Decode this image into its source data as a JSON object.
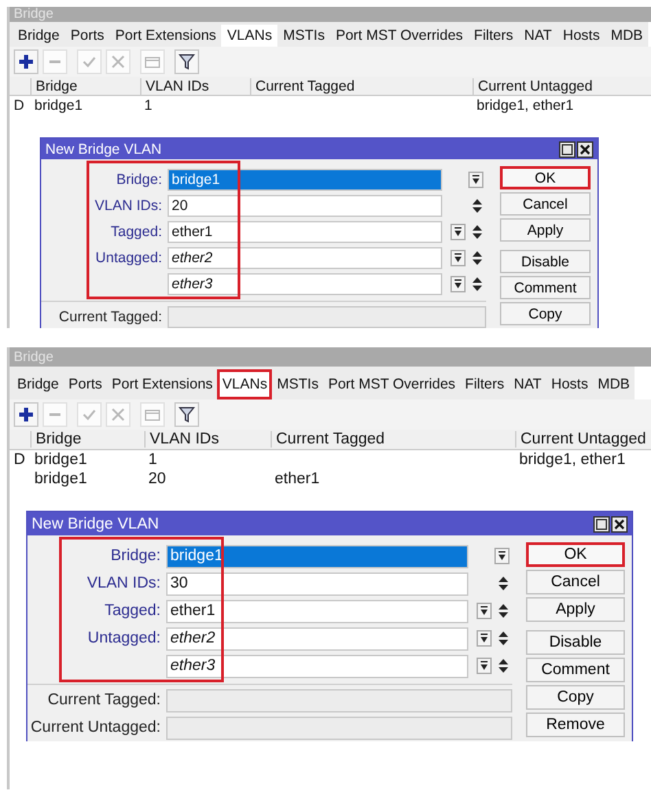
{
  "panels": [
    {
      "window_title": "Bridge",
      "tabs": [
        {
          "label": "Bridge",
          "selected": false,
          "highlighted": false
        },
        {
          "label": "Ports",
          "selected": false,
          "highlighted": false
        },
        {
          "label": "Port Extensions",
          "selected": false,
          "highlighted": false
        },
        {
          "label": "VLANs",
          "selected": true,
          "highlighted": false
        },
        {
          "label": "MSTIs",
          "selected": false,
          "highlighted": false
        },
        {
          "label": "Port MST Overrides",
          "selected": false,
          "highlighted": false
        },
        {
          "label": "Filters",
          "selected": false,
          "highlighted": false
        },
        {
          "label": "NAT",
          "selected": false,
          "highlighted": false
        },
        {
          "label": "Hosts",
          "selected": false,
          "highlighted": false
        },
        {
          "label": "MDB",
          "selected": false,
          "highlighted": false
        }
      ],
      "toolbar": [
        {
          "kind": "add",
          "disabled": false
        },
        {
          "kind": "remove",
          "disabled": true
        },
        {
          "kind": "enable",
          "disabled": true
        },
        {
          "kind": "disable",
          "disabled": true
        },
        {
          "kind": "comment",
          "disabled": true
        },
        {
          "kind": "filter",
          "disabled": false
        }
      ],
      "table": {
        "columns": [
          "Bridge",
          "VLAN IDs",
          "Current Tagged",
          "Current Untagged"
        ],
        "rows": [
          {
            "flag": "D",
            "bridge": "bridge1",
            "vlan_ids": "1",
            "current_untagged": "bridge1, ether1"
          }
        ]
      },
      "dialog": {
        "title": "New Bridge VLAN",
        "fields": [
          {
            "label": "Bridge:",
            "value": {
              "text": "bridge1",
              "kind": "selected"
            },
            "kind": "dropdown",
            "highlighted": true
          },
          {
            "label": "VLAN IDs:",
            "value": {
              "text": "20",
              "kind": "plain"
            },
            "kind": "spin",
            "highlighted": true
          },
          {
            "label": "Tagged:",
            "value": {
              "text": "ether1",
              "kind": "plain"
            },
            "kind": "dropdown-spin",
            "highlighted": true
          },
          {
            "label": "Untagged:",
            "value": {
              "text": "ether2",
              "kind": "italic"
            },
            "kind": "dropdown-spin",
            "highlighted": true
          },
          {
            "value": {
              "text": "ether3",
              "kind": "italic"
            },
            "kind": "dropdown-spin",
            "highlighted": true
          },
          {
            "label": "Current Tagged:",
            "kind": "readonly"
          }
        ],
        "buttons": [
          {
            "label": "OK",
            "highlighted": true
          },
          {
            "label": "Cancel",
            "highlighted": false
          },
          {
            "label": "Apply",
            "highlighted": false
          },
          {
            "label": "Disable",
            "highlighted": false
          },
          {
            "label": "Comment",
            "highlighted": false
          },
          {
            "label": "Copy",
            "highlighted": false
          }
        ]
      }
    },
    {
      "window_title": "Bridge",
      "tabs": [
        {
          "label": "Bridge",
          "selected": false,
          "highlighted": false
        },
        {
          "label": "Ports",
          "selected": false,
          "highlighted": false
        },
        {
          "label": "Port Extensions",
          "selected": false,
          "highlighted": false
        },
        {
          "label": "VLANs",
          "selected": true,
          "highlighted": true
        },
        {
          "label": "MSTIs",
          "selected": false,
          "highlighted": false
        },
        {
          "label": "Port MST Overrides",
          "selected": false,
          "highlighted": false
        },
        {
          "label": "Filters",
          "selected": false,
          "highlighted": false
        },
        {
          "label": "NAT",
          "selected": false,
          "highlighted": false
        },
        {
          "label": "Hosts",
          "selected": false,
          "highlighted": false
        },
        {
          "label": "MDB",
          "selected": false,
          "highlighted": false
        }
      ],
      "toolbar": [
        {
          "kind": "add",
          "disabled": false
        },
        {
          "kind": "remove",
          "disabled": true
        },
        {
          "kind": "enable",
          "disabled": true
        },
        {
          "kind": "disable",
          "disabled": true
        },
        {
          "kind": "comment",
          "disabled": true
        },
        {
          "kind": "filter",
          "disabled": false
        }
      ],
      "table": {
        "columns": [
          "Bridge",
          "VLAN IDs",
          "Current Tagged",
          "Current Untagged"
        ],
        "rows": [
          {
            "flag": "D",
            "bridge": "bridge1",
            "vlan_ids": "1",
            "current_untagged": "bridge1, ether1"
          },
          {
            "bridge": "bridge1",
            "vlan_ids": "20",
            "current_tagged": "ether1"
          }
        ]
      },
      "dialog": {
        "title": "New Bridge VLAN",
        "fields": [
          {
            "label": "Bridge:",
            "value": {
              "text": "bridge1",
              "kind": "selected"
            },
            "kind": "dropdown",
            "highlighted": true
          },
          {
            "label": "VLAN IDs:",
            "value": {
              "text": "30",
              "kind": "plain"
            },
            "kind": "spin",
            "highlighted": true
          },
          {
            "label": "Tagged:",
            "value": {
              "text": "ether1",
              "kind": "plain"
            },
            "kind": "dropdown-spin",
            "highlighted": true
          },
          {
            "label": "Untagged:",
            "value": {
              "text": "ether2",
              "kind": "italic"
            },
            "kind": "dropdown-spin",
            "highlighted": true
          },
          {
            "value": {
              "text": "ether3",
              "kind": "italic"
            },
            "kind": "dropdown-spin",
            "highlighted": true
          },
          {
            "label": "Current Tagged:",
            "kind": "readonly"
          },
          {
            "label": "Current Untagged:",
            "kind": "readonly"
          }
        ],
        "buttons": [
          {
            "label": "OK",
            "highlighted": true
          },
          {
            "label": "Cancel",
            "highlighted": false
          },
          {
            "label": "Apply",
            "highlighted": false
          },
          {
            "label": "Disable",
            "highlighted": false
          },
          {
            "label": "Comment",
            "highlighted": false
          },
          {
            "label": "Copy",
            "highlighted": false
          },
          {
            "label": "Remove",
            "highlighted": false
          }
        ]
      }
    }
  ]
}
